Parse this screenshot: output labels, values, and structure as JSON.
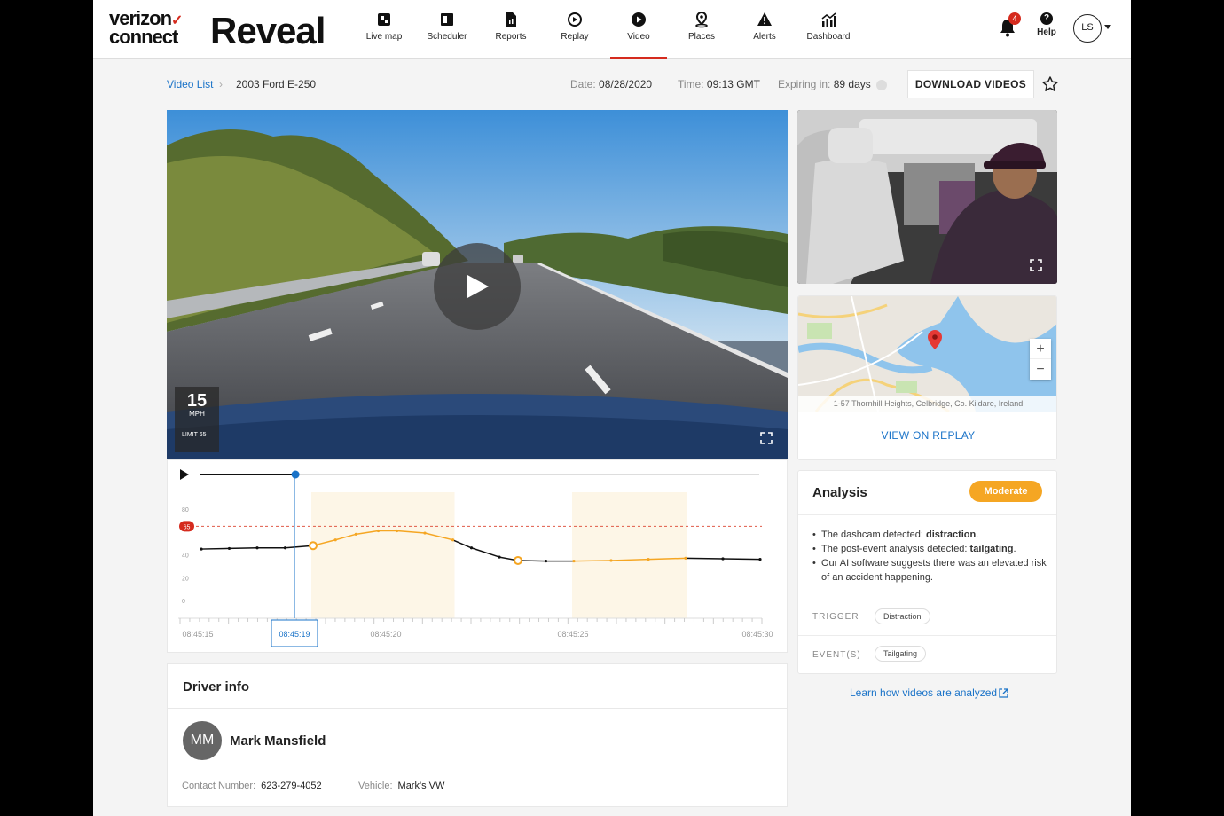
{
  "nav": {
    "logo_brand": "verizon",
    "logo_brand_2": "connect",
    "logo_product": "Reveal",
    "items": [
      {
        "label": "Live map",
        "icon": "live-map-icon"
      },
      {
        "label": "Scheduler",
        "icon": "scheduler-icon"
      },
      {
        "label": "Reports",
        "icon": "reports-icon"
      },
      {
        "label": "Replay",
        "icon": "replay-icon"
      },
      {
        "label": "Video",
        "icon": "video-icon",
        "active": true
      },
      {
        "label": "Places",
        "icon": "places-icon"
      },
      {
        "label": "Alerts",
        "icon": "alerts-icon"
      },
      {
        "label": "Dashboard",
        "icon": "dashboard-icon"
      }
    ],
    "notification_count": "4",
    "help_label": "Help",
    "user_initials": "LS",
    "accent": "#d52b1e"
  },
  "breadcrumb": {
    "link": "Video List",
    "separator": "›",
    "current": "2003 Ford E-250"
  },
  "meta": {
    "date_label": "Date:",
    "date": "08/28/2020",
    "time_label": "Time:",
    "time": "09:13 GMT",
    "expiring_label": "Expiring in:",
    "expiring": "89 days"
  },
  "download_label": "DOWNLOAD VIDEOS",
  "video": {
    "speed": "15",
    "speed_unit": "MPH",
    "limit_label": "LIMIT 65"
  },
  "timeline": {
    "progress": 0.17
  },
  "chart_data": {
    "type": "line",
    "yticks": [
      "80",
      "65",
      "40",
      "20",
      "0"
    ],
    "speed_limit": 65,
    "ylim": [
      0,
      80
    ],
    "xticks": [
      "08:45:15",
      "08:45:19",
      "08:45:20",
      "08:45:25",
      "08:45:30"
    ],
    "selected_time": "08:45:19",
    "series": [
      {
        "x": [
          0.0,
          0.15,
          0.3,
          0.45,
          0.6,
          0.72,
          0.83,
          0.95,
          1.05,
          1.2,
          1.35,
          1.45,
          1.6,
          1.7,
          1.85,
          2.0,
          2.2,
          2.4,
          2.6,
          2.8,
          3.0
        ],
        "y": [
          45,
          45.5,
          46,
          46,
          48,
          53,
          58,
          61,
          61,
          59,
          53,
          46,
          38,
          35,
          34.5,
          34.5,
          35,
          36,
          37,
          36.5,
          36
        ]
      }
    ],
    "highlight_ranges": [
      [
        0.6,
        1.35
      ],
      [
        2.0,
        2.6
      ]
    ],
    "highlight_color": "#f5a623"
  },
  "driver": {
    "title": "Driver info",
    "initials": "MM",
    "name": "Mark Mansfield",
    "contact_label": "Contact Number:",
    "contact": "623-279-4052",
    "vehicle_label": "Vehicle:",
    "vehicle": "Mark's VW"
  },
  "map": {
    "address": "1-57 Thornhill Heights, Celbridge, Co. Kildare, Ireland",
    "zoom_in": "+",
    "zoom_out": "−",
    "view_on_replay": "VIEW ON REPLAY"
  },
  "analysis": {
    "title": "Analysis",
    "severity": "Moderate",
    "severity_color": "#f5a623",
    "bullets": [
      {
        "text": "The dashcam detected: ",
        "bold": "distraction",
        "tail": "."
      },
      {
        "text": "The post-event analysis detected: ",
        "bold": "tailgating",
        "tail": "."
      },
      {
        "text": "Our AI software suggests there was an elevated risk of an accident happening.",
        "bold": "",
        "tail": ""
      }
    ],
    "trigger_label": "TRIGGER",
    "trigger": "Distraction",
    "events_label": "EVENT(S)",
    "events": "Tailgating",
    "learn_link": "Learn how videos are analyzed"
  }
}
